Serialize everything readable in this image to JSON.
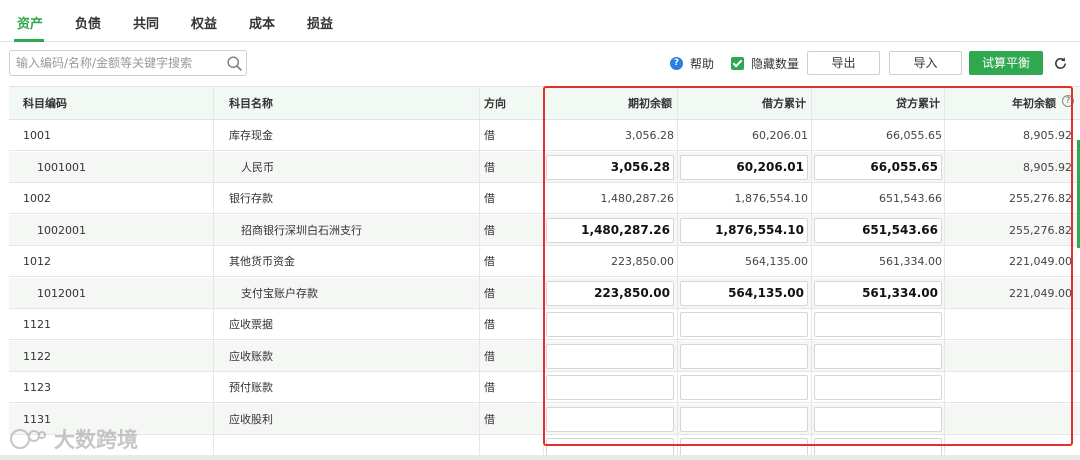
{
  "tabs": [
    "资产",
    "负债",
    "共同",
    "权益",
    "成本",
    "损益"
  ],
  "search": {
    "placeholder": "输入编码/名称/金额等关键字搜索"
  },
  "toolbar": {
    "help_label": "帮助",
    "hide_quantity_label": "隐藏数量",
    "export_label": "导出",
    "import_label": "导入",
    "trial_balance_label": "试算平衡"
  },
  "table": {
    "columns": [
      "科目编码",
      "科目名称",
      "方向",
      "期初余额",
      "借方累计",
      "贷方累计",
      "年初余额"
    ],
    "rows": [
      {
        "code": "1001",
        "name": "库存现金",
        "dir": "借",
        "opening": "3,056.28",
        "debit": "60,206.01",
        "credit": "66,055.65",
        "year_start": "8,905.92",
        "editable": false
      },
      {
        "code": "1001001",
        "name": "人民币",
        "dir": "借",
        "opening": "3,056.28",
        "debit": "60,206.01",
        "credit": "66,055.65",
        "year_start": "8,905.92",
        "editable": true
      },
      {
        "code": "1002",
        "name": "银行存款",
        "dir": "借",
        "opening": "1,480,287.26",
        "debit": "1,876,554.10",
        "credit": "651,543.66",
        "year_start": "255,276.82",
        "editable": false
      },
      {
        "code": "1002001",
        "name": "招商银行深圳白石洲支行",
        "dir": "借",
        "opening": "1,480,287.26",
        "debit": "1,876,554.10",
        "credit": "651,543.66",
        "year_start": "255,276.82",
        "editable": true
      },
      {
        "code": "1012",
        "name": "其他货币资金",
        "dir": "借",
        "opening": "223,850.00",
        "debit": "564,135.00",
        "credit": "561,334.00",
        "year_start": "221,049.00",
        "editable": false
      },
      {
        "code": "1012001",
        "name": "支付宝账户存款",
        "dir": "借",
        "opening": "223,850.00",
        "debit": "564,135.00",
        "credit": "561,334.00",
        "year_start": "221,049.00",
        "editable": true
      },
      {
        "code": "1121",
        "name": "应收票据",
        "dir": "借",
        "opening": "",
        "debit": "",
        "credit": "",
        "year_start": "",
        "editable": true
      },
      {
        "code": "1122",
        "name": "应收账款",
        "dir": "借",
        "opening": "",
        "debit": "",
        "credit": "",
        "year_start": "",
        "editable": true
      },
      {
        "code": "1123",
        "name": "预付账款",
        "dir": "借",
        "opening": "",
        "debit": "",
        "credit": "",
        "year_start": "",
        "editable": true
      },
      {
        "code": "1131",
        "name": "应收股利",
        "dir": "借",
        "opening": "",
        "debit": "",
        "credit": "",
        "year_start": "",
        "editable": true
      },
      {
        "code": "",
        "name": "",
        "dir": "",
        "opening": "",
        "debit": "",
        "credit": "",
        "year_start": "",
        "editable": true
      }
    ]
  },
  "watermark": {
    "text": "大数跨境"
  },
  "colors": {
    "accent": "#2fa84f",
    "highlight_border": "#e0322b",
    "help_icon": "#2a7de1",
    "header_bg": "#f2f8f3"
  }
}
